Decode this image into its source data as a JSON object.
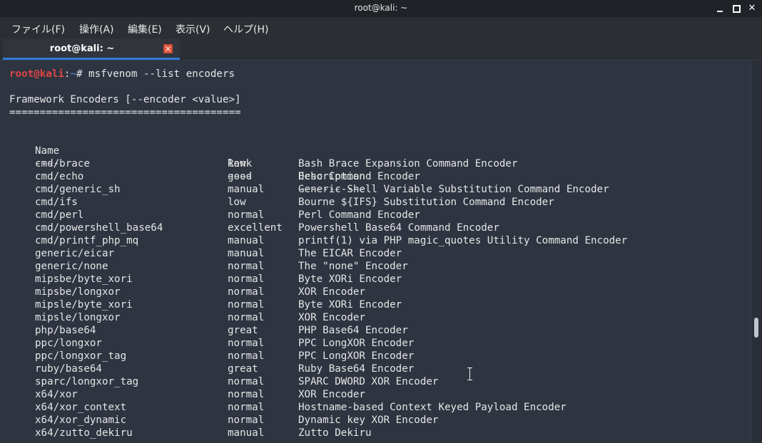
{
  "window": {
    "title": "root@kali: ~",
    "controls": {
      "minimize": "minimize-icon",
      "maximize": "maximize-icon",
      "close": "close-icon"
    }
  },
  "menu": {
    "items": [
      {
        "label": "ファイル(F)"
      },
      {
        "label": "操作(A)"
      },
      {
        "label": "編集(E)"
      },
      {
        "label": "表示(V)"
      },
      {
        "label": "ヘルプ(H)"
      }
    ]
  },
  "tab": {
    "label": "root@kali: ~",
    "accent": "#2f7be0",
    "close_color": "#e0553f"
  },
  "terminal": {
    "prompt": {
      "user": "root@kali",
      "sep": ":",
      "path": "~",
      "symbol": "#",
      "command": " msfvenom --list encoders"
    },
    "section_title": "Framework Encoders [--encoder <value>]",
    "rule": "======================================",
    "headers": {
      "name": "Name",
      "rank": "Rank",
      "description": "Description"
    },
    "underlines": {
      "name": "----",
      "rank": "----",
      "description": "-----------"
    },
    "rows": [
      {
        "name": "cmd/brace",
        "rank": "low",
        "description": "Bash Brace Expansion Command Encoder"
      },
      {
        "name": "cmd/echo",
        "rank": "good",
        "description": "Echo Command Encoder"
      },
      {
        "name": "cmd/generic_sh",
        "rank": "manual",
        "description": "Generic Shell Variable Substitution Command Encoder"
      },
      {
        "name": "cmd/ifs",
        "rank": "low",
        "description": "Bourne ${IFS} Substitution Command Encoder"
      },
      {
        "name": "cmd/perl",
        "rank": "normal",
        "description": "Perl Command Encoder"
      },
      {
        "name": "cmd/powershell_base64",
        "rank": "excellent",
        "description": "Powershell Base64 Command Encoder"
      },
      {
        "name": "cmd/printf_php_mq",
        "rank": "manual",
        "description": "printf(1) via PHP magic_quotes Utility Command Encoder"
      },
      {
        "name": "generic/eicar",
        "rank": "manual",
        "description": "The EICAR Encoder"
      },
      {
        "name": "generic/none",
        "rank": "normal",
        "description": "The \"none\" Encoder"
      },
      {
        "name": "mipsbe/byte_xori",
        "rank": "normal",
        "description": "Byte XORi Encoder"
      },
      {
        "name": "mipsbe/longxor",
        "rank": "normal",
        "description": "XOR Encoder"
      },
      {
        "name": "mipsle/byte_xori",
        "rank": "normal",
        "description": "Byte XORi Encoder"
      },
      {
        "name": "mipsle/longxor",
        "rank": "normal",
        "description": "XOR Encoder"
      },
      {
        "name": "php/base64",
        "rank": "great",
        "description": "PHP Base64 Encoder"
      },
      {
        "name": "ppc/longxor",
        "rank": "normal",
        "description": "PPC LongXOR Encoder"
      },
      {
        "name": "ppc/longxor_tag",
        "rank": "normal",
        "description": "PPC LongXOR Encoder"
      },
      {
        "name": "ruby/base64",
        "rank": "great",
        "description": "Ruby Base64 Encoder"
      },
      {
        "name": "sparc/longxor_tag",
        "rank": "normal",
        "description": "SPARC DWORD XOR Encoder"
      },
      {
        "name": "x64/xor",
        "rank": "normal",
        "description": "XOR Encoder"
      },
      {
        "name": "x64/xor_context",
        "rank": "normal",
        "description": "Hostname-based Context Keyed Payload Encoder"
      },
      {
        "name": "x64/xor_dynamic",
        "rank": "normal",
        "description": "Dynamic key XOR Encoder"
      },
      {
        "name": "x64/zutto_dekiru",
        "rank": "manual",
        "description": "Zutto Dekiru"
      }
    ],
    "colors": {
      "background": "#2e3440",
      "text": "#e6e6e6",
      "prompt_user": "#e04646",
      "prompt_path": "#4f8fe6"
    }
  },
  "scrollbar": {
    "thumb_position": 0.71
  }
}
